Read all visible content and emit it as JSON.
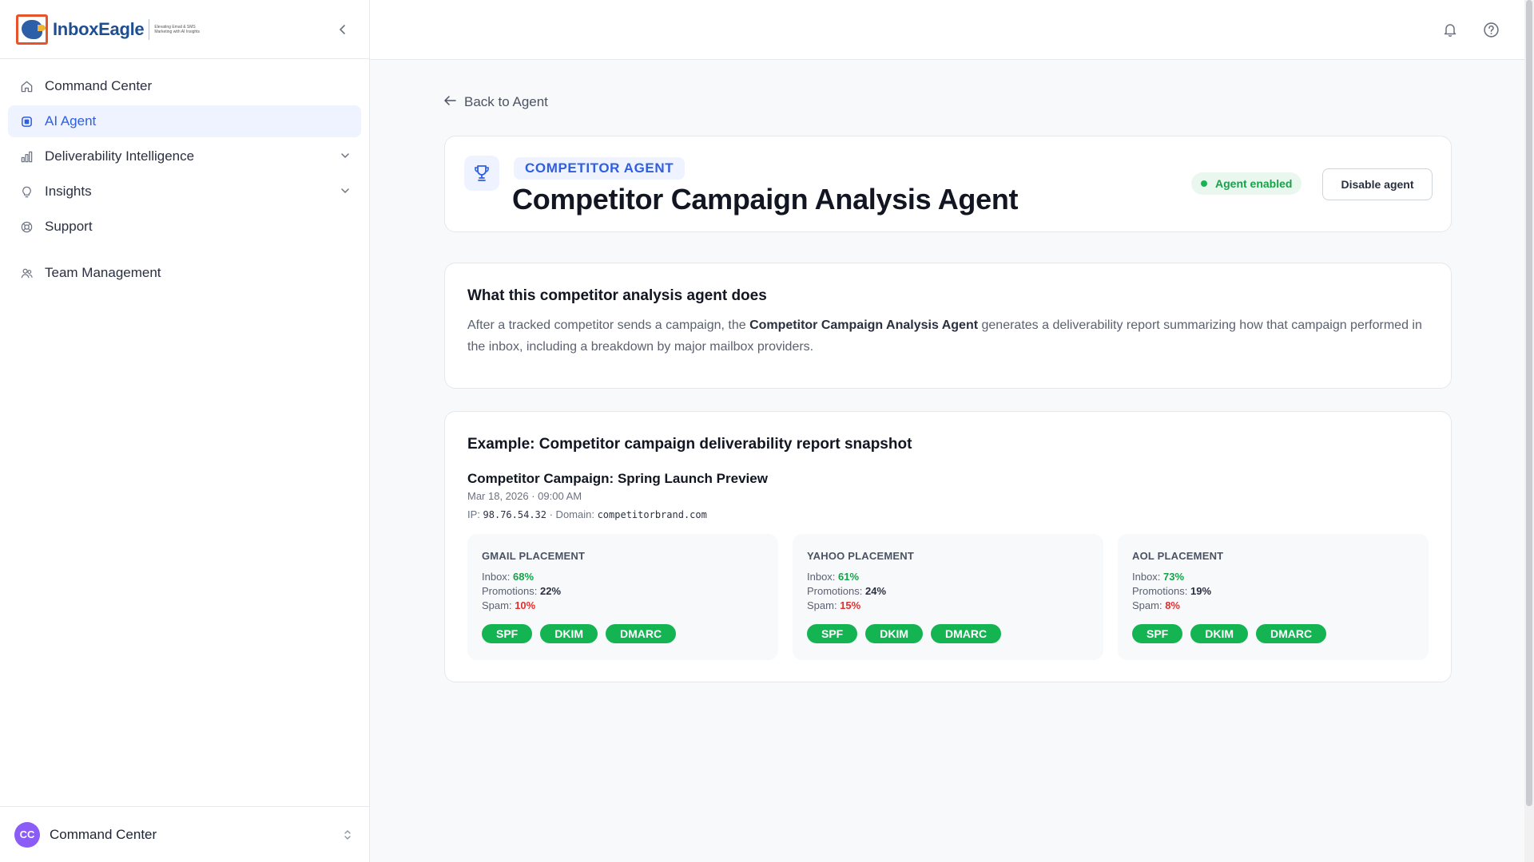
{
  "brand": {
    "name": "InboxEagle",
    "tagline": "Elevating Email & SMS Marketing with AI Insights"
  },
  "sidebar": {
    "items": [
      {
        "label": "Command Center",
        "icon": "home-icon"
      },
      {
        "label": "AI Agent",
        "icon": "agent-icon",
        "active": true
      },
      {
        "label": "Deliverability Intelligence",
        "icon": "bar-chart-icon",
        "expandable": true
      },
      {
        "label": "Insights",
        "icon": "lightbulb-icon",
        "expandable": true
      },
      {
        "label": "Support",
        "icon": "lifebuoy-icon"
      },
      {
        "label": "Team Management",
        "icon": "users-icon"
      }
    ],
    "workspace": {
      "initials": "CC",
      "name": "Command Center"
    }
  },
  "topbar": {
    "icons": [
      "bell-icon",
      "help-icon"
    ]
  },
  "main": {
    "back_label": "Back to Agent",
    "header": {
      "category": "COMPETITOR AGENT",
      "title": "Competitor Campaign Analysis Agent",
      "status": "Agent enabled",
      "disable_label": "Disable agent"
    },
    "description": {
      "title": "What this competitor analysis agent does",
      "text_before": "After a tracked competitor sends a campaign, the ",
      "text_bold": "Competitor Campaign Analysis Agent",
      "text_after": " generates a deliverability report summarizing how that campaign performed in the inbox, including a breakdown by major mailbox providers."
    },
    "example": {
      "title": "Example: Competitor campaign deliverability report snapshot",
      "campaign_name": "Competitor Campaign: Spring Launch Preview",
      "campaign_date": "Mar 18, 2026 · 09:00 AM",
      "ip_label": "IP: ",
      "ip_value": "98.76.54.32",
      "domain_label": " · Domain: ",
      "domain_value": "competitorbrand.com",
      "placements": [
        {
          "title": "GMAIL PLACEMENT",
          "inbox": "68%",
          "promotions": "22%",
          "spam": "10%"
        },
        {
          "title": "YAHOO PLACEMENT",
          "inbox": "61%",
          "promotions": "24%",
          "spam": "15%"
        },
        {
          "title": "AOL PLACEMENT",
          "inbox": "73%",
          "promotions": "19%",
          "spam": "8%"
        }
      ],
      "labels": {
        "inbox": "Inbox: ",
        "promotions": "Promotions: ",
        "spam": "Spam: "
      },
      "auth_badges": [
        "SPF",
        "DKIM",
        "DMARC"
      ]
    }
  },
  "colors": {
    "accent": "#2f5fe0",
    "success": "#15b453",
    "danger": "#e03131"
  }
}
